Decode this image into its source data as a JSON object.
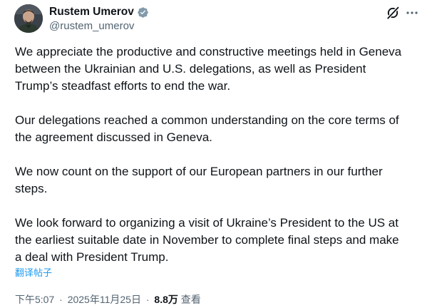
{
  "author": {
    "display_name": "Rustem Umerov",
    "handle": "@rustem_umerov",
    "verified": true
  },
  "icons": {
    "avatar": "profile-photo",
    "verified": "verified-badge-icon",
    "grok": "grok-icon",
    "more": "more-icon"
  },
  "tweet": {
    "paragraphs": [
      "We appreciate the productive and constructive meetings held in Geneva\nbetween the Ukrainian and U.S. delegations, as well as President\nTrump’s steadfast efforts to end the war.",
      "Our delegations reached a common understanding on the core terms of\nthe agreement discussed in Geneva.",
      "We now count on the support of our European partners in our further\nsteps.",
      "We look forward to organizing a visit of Ukraine’s President to the US at\nthe earliest suitable date in November to complete final steps and make\na deal with President Trump."
    ],
    "translate_label": "翻译帖子"
  },
  "meta": {
    "time": "下午5:07",
    "separator": "·",
    "date": "2025年11月25日",
    "views_count": "8.8万",
    "views_label": "查看"
  },
  "colors": {
    "text": "#0f1419",
    "secondary": "#536471",
    "link": "#1d9bf0",
    "verified": "#829aab"
  }
}
